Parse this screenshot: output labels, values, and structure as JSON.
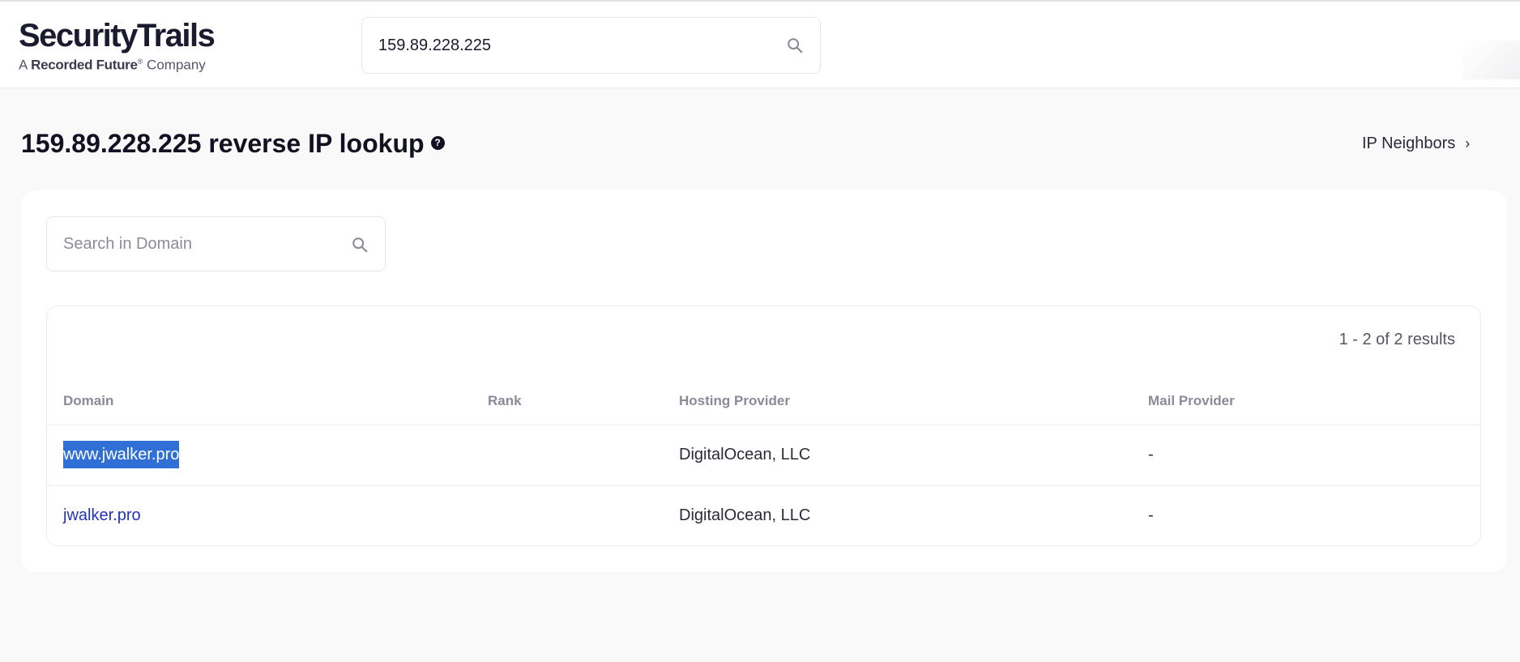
{
  "header": {
    "logo_main": "SecurityTrails",
    "logo_prefix": "A",
    "logo_brand": "Recorded Future",
    "logo_reg": "®",
    "logo_suffix": "Company",
    "search_value": "159.89.228.225",
    "search_icon": "search-icon"
  },
  "page": {
    "title": "159.89.228.225 reverse IP lookup",
    "help_icon": "?",
    "ip_neighbors_label": "IP Neighbors",
    "ip_neighbors_chevron": "›"
  },
  "domain_search": {
    "placeholder": "Search in Domain"
  },
  "results": {
    "count_text": "1 - 2 of 2 results",
    "columns": {
      "domain": "Domain",
      "rank": "Rank",
      "hosting": "Hosting Provider",
      "mail": "Mail Provider"
    },
    "rows": [
      {
        "domain": "www.jwalker.pro",
        "rank": "",
        "hosting": "DigitalOcean, LLC",
        "mail": "-"
      },
      {
        "domain": "jwalker.pro",
        "rank": "",
        "hosting": "DigitalOcean, LLC",
        "mail": "-"
      }
    ]
  },
  "colors": {
    "link": "#2233bb",
    "selection": "#2f6fd6",
    "background": "#f9f9f9"
  }
}
